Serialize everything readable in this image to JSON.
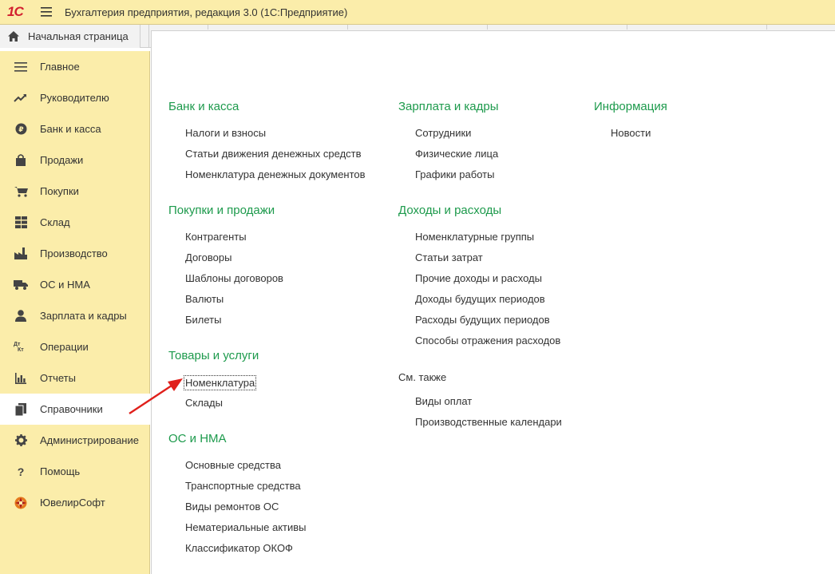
{
  "app": {
    "logo": "1С",
    "title": "Бухгалтерия предприятия, редакция 3.0  (1С:Предприятие)"
  },
  "tabs": {
    "home": "Начальная страница"
  },
  "sidebar": {
    "items": [
      {
        "label": "Главное",
        "icon": "list-icon"
      },
      {
        "label": "Руководителю",
        "icon": "trend-icon"
      },
      {
        "label": "Банк и касса",
        "icon": "coin-icon"
      },
      {
        "label": "Продажи",
        "icon": "bag-icon"
      },
      {
        "label": "Покупки",
        "icon": "cart-icon"
      },
      {
        "label": "Склад",
        "icon": "grid-icon"
      },
      {
        "label": "Производство",
        "icon": "factory-icon"
      },
      {
        "label": "ОС и НМА",
        "icon": "truck-icon"
      },
      {
        "label": "Зарплата и кадры",
        "icon": "person-icon"
      },
      {
        "label": "Операции",
        "icon": "dt-kt-icon",
        "glyph": "Дт\nКт"
      },
      {
        "label": "Отчеты",
        "icon": "bar-chart-icon"
      },
      {
        "label": "Справочники",
        "icon": "books-icon",
        "active": true
      },
      {
        "label": "Администрирование",
        "icon": "gear-icon"
      },
      {
        "label": "Помощь",
        "icon": "question-icon",
        "glyph": "?"
      },
      {
        "label": "ЮвелирСофт",
        "icon": "jewel-icon"
      }
    ]
  },
  "content": {
    "sections": {
      "bank": {
        "title": "Банк и касса",
        "links": [
          "Налоги и взносы",
          "Статьи движения денежных средств",
          "Номенклатура денежных документов"
        ]
      },
      "purchases_sales": {
        "title": "Покупки и продажи",
        "links": [
          "Контрагенты",
          "Договоры",
          "Шаблоны договоров",
          "Валюты",
          "Билеты"
        ]
      },
      "goods": {
        "title": "Товары и услуги",
        "links": [
          "Номенклатура",
          "Склады"
        ]
      },
      "os_nma": {
        "title": "ОС и НМА",
        "links": [
          "Основные средства",
          "Транспортные средства",
          "Виды ремонтов ОС",
          "Нематериальные активы",
          "Классификатор ОКОФ"
        ]
      },
      "salary": {
        "title": "Зарплата и кадры",
        "links": [
          "Сотрудники",
          "Физические лица",
          "Графики работы"
        ]
      },
      "income_expense": {
        "title": "Доходы и расходы",
        "links": [
          "Номенклатурные группы",
          "Статьи затрат",
          "Прочие доходы и расходы",
          "Доходы будущих периодов",
          "Расходы будущих периодов",
          "Способы отражения расходов"
        ]
      },
      "see_also": {
        "title": "См. также",
        "links": [
          "Виды оплат",
          "Производственные календари"
        ]
      },
      "info": {
        "title": "Информация",
        "links": [
          "Новости"
        ]
      }
    }
  },
  "colors": {
    "section_title": "#1d9a4c",
    "sidebar_bg": "#fbedaa",
    "arrow": "#e0201b",
    "logo": "#d2202f"
  }
}
